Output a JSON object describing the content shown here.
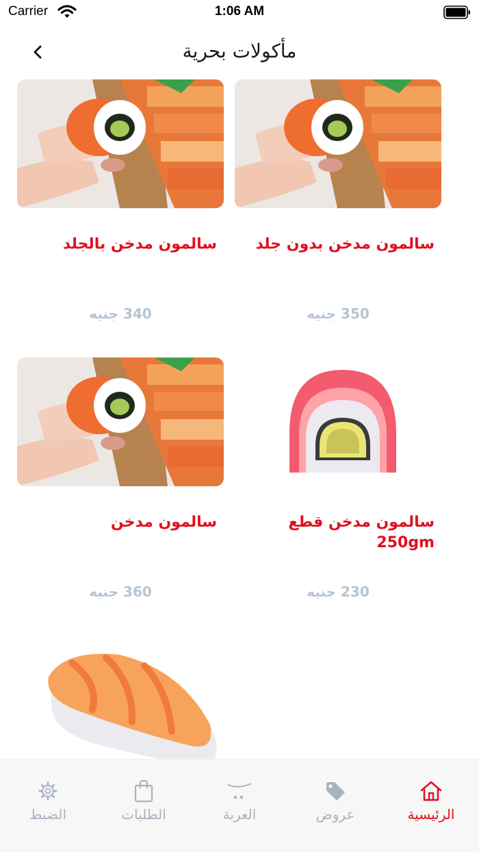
{
  "status_bar": {
    "carrier": "Carrier",
    "time": "1:06 AM"
  },
  "nav": {
    "title": "مأكولات بحرية",
    "back_icon": "chevron-left-icon"
  },
  "products": [
    {
      "name": "سالمون مدخن بدون جلد",
      "price": "350 جنيه",
      "image": "salmon-roll-photo"
    },
    {
      "name": "سالمون مدخن بالجلد",
      "price": "340 جنيه",
      "image": "salmon-roll-photo"
    },
    {
      "name": "سالمون مدخن قطع 250gm",
      "price": "230 جنيه",
      "image": "sushi-roll-illustration"
    },
    {
      "name": "سالمون مدخن",
      "price": "360 جنيه",
      "image": "salmon-roll-photo"
    },
    {
      "name": "",
      "price": "",
      "image": "salmon-nigiri-illustration"
    }
  ],
  "tabs": [
    {
      "label": "الرئيسية",
      "icon": "home-icon",
      "active": true
    },
    {
      "label": "عروض",
      "icon": "tag-icon",
      "active": false
    },
    {
      "label": "العربة",
      "icon": "cart-icon",
      "active": false
    },
    {
      "label": "الطلبات",
      "icon": "shopping-bag-icon",
      "active": false
    },
    {
      "label": "الضبط",
      "icon": "gear-icon",
      "active": false
    }
  ],
  "colors": {
    "accent": "#e0101e",
    "price": "#b7c4d3",
    "tab_inactive": "#a9b3bf"
  }
}
